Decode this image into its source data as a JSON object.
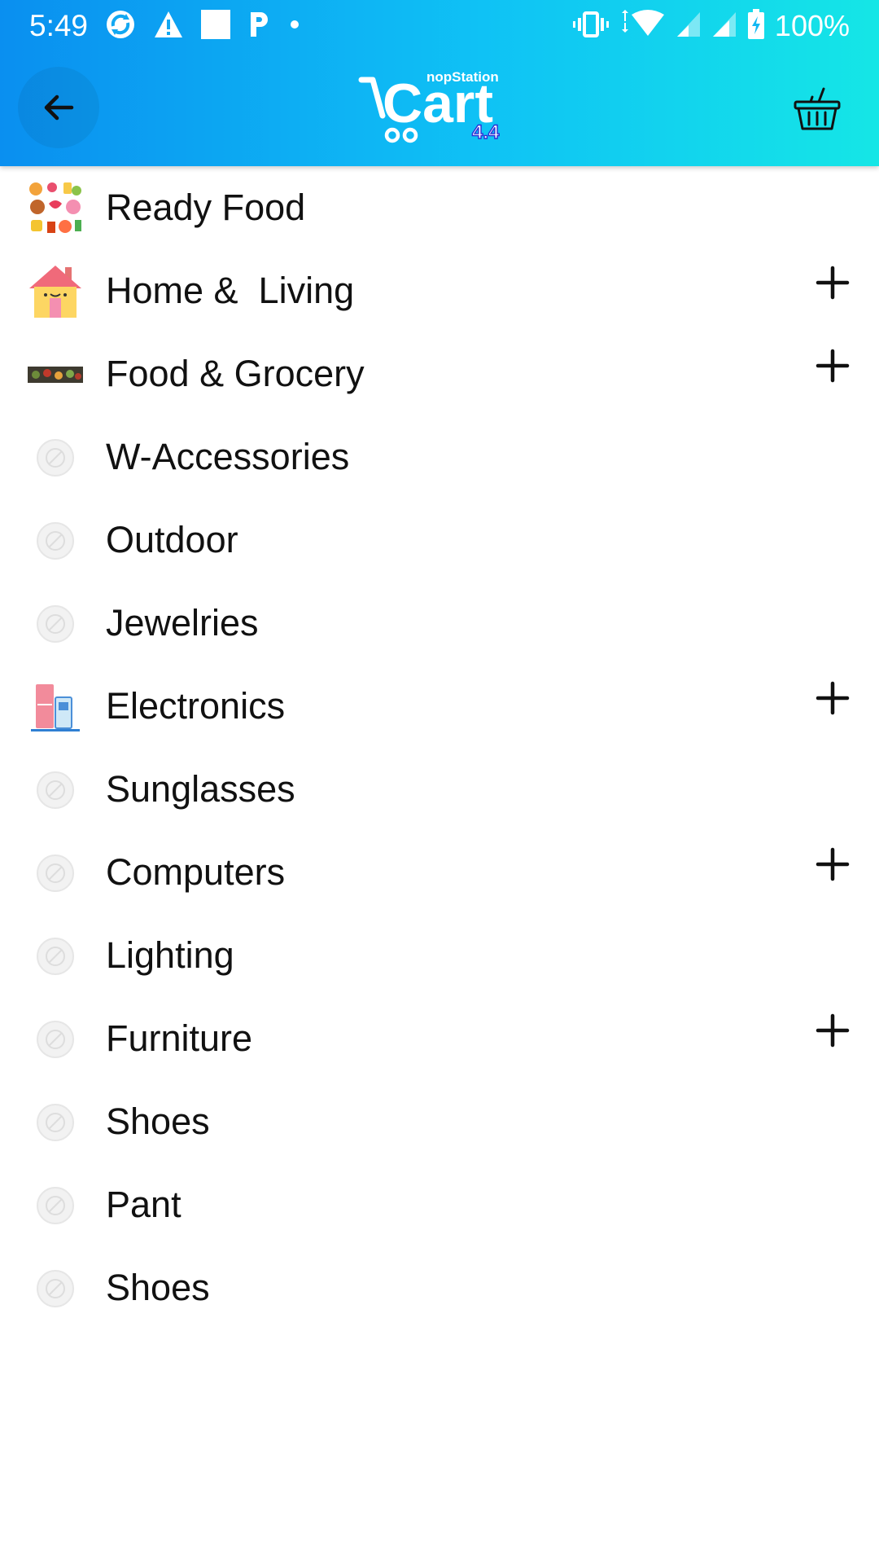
{
  "status_bar": {
    "time": "5:49",
    "battery": "100%",
    "left_icons": [
      "sync-icon",
      "warning-icon",
      "square-icon",
      "parking-icon",
      "dot-icon"
    ],
    "right_icons": [
      "vibrate-icon",
      "wifi-icon",
      "signal-icon",
      "signal-icon",
      "battery-charging-icon"
    ]
  },
  "app_bar": {
    "logo_brand": "nopStation",
    "logo_word": "Cart",
    "logo_version": "4.4",
    "colors": {
      "gradient_start": "#0a8ff0",
      "gradient_mid": "#0fc2f5",
      "gradient_end": "#15e6e6"
    }
  },
  "categories": [
    {
      "label": "Ready Food",
      "thumb": "food-collage-thumbnail",
      "expandable": false
    },
    {
      "label": "Home &  Living",
      "thumb": "house-thumbnail",
      "expandable": true
    },
    {
      "label": "Food & Grocery",
      "thumb": "grocery-banner-thumbnail",
      "expandable": true
    },
    {
      "label": "W-Accessories",
      "thumb": "no-image-placeholder",
      "expandable": false
    },
    {
      "label": "Outdoor",
      "thumb": "no-image-placeholder",
      "expandable": false
    },
    {
      "label": "Jewelries",
      "thumb": "no-image-placeholder",
      "expandable": false
    },
    {
      "label": "Electronics",
      "thumb": "appliances-thumbnail",
      "expandable": true
    },
    {
      "label": "Sunglasses",
      "thumb": "no-image-placeholder",
      "expandable": false
    },
    {
      "label": "Computers",
      "thumb": "no-image-placeholder",
      "expandable": true
    },
    {
      "label": "Lighting",
      "thumb": "no-image-placeholder",
      "expandable": false
    },
    {
      "label": "Furniture",
      "thumb": "no-image-placeholder",
      "expandable": true
    },
    {
      "label": "Shoes",
      "thumb": "no-image-placeholder",
      "expandable": false
    },
    {
      "label": "Pant",
      "thumb": "no-image-placeholder",
      "expandable": false
    },
    {
      "label": "Shoes",
      "thumb": "no-image-placeholder",
      "expandable": false
    }
  ]
}
